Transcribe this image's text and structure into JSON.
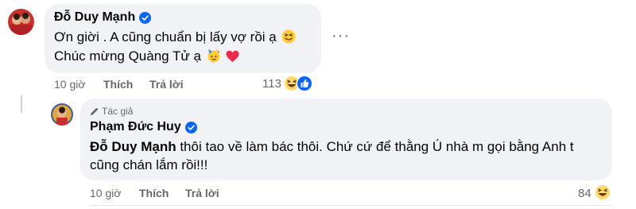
{
  "comments": [
    {
      "author": "Đỗ Duy Mạnh",
      "lines": [
        "Ơn giời . A cũng chuẩn bị lấy vợ rồi ạ",
        "Chúc mừng Quàng Tử ạ"
      ],
      "time": "10 giờ",
      "like_label": "Thích",
      "reply_label": "Trả lời",
      "reaction_count": "113",
      "reactions": [
        "haha-icon",
        "like-icon"
      ]
    },
    {
      "author_badge": "Tác giả",
      "author": "Phạm Đức Huy",
      "mention": "Đỗ Duy Mạnh",
      "line1_rest": " thôi tao về làm bác thôi. Chứ cứ để thằng Ú nhà m gọi bằng Anh t",
      "line2": "cũng chán lắm rồi!!!",
      "time": "10 giờ",
      "like_label": "Thích",
      "reply_label": "Trả lời",
      "reaction_count": "84",
      "reactions": [
        "haha-icon"
      ]
    }
  ],
  "colors": {
    "bubble": "#f0f2f5",
    "verified": "#0866ff",
    "meta_text": "#65676b",
    "heart": "#f02849"
  }
}
